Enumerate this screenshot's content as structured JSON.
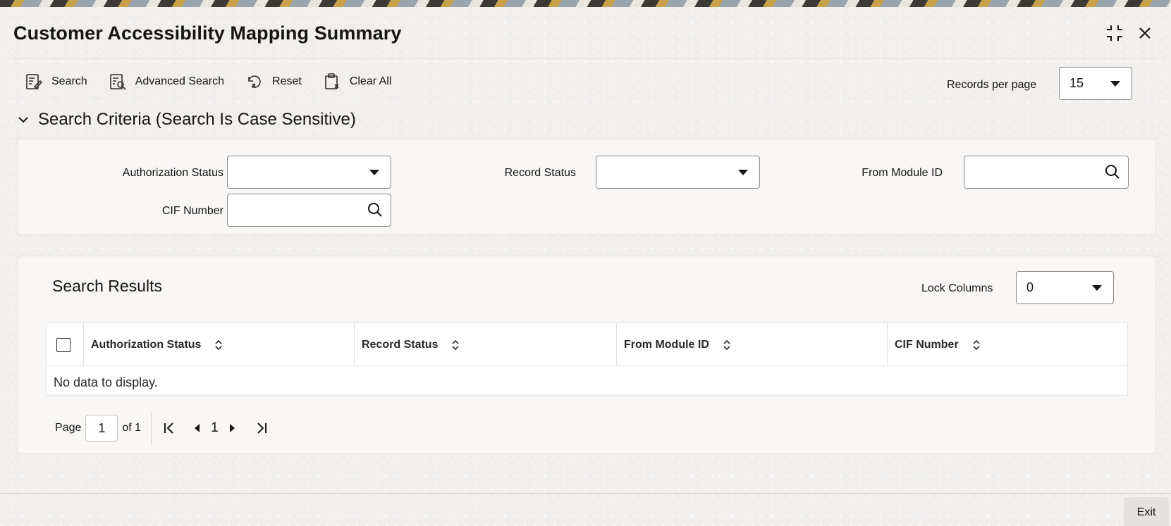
{
  "window": {
    "title": "Customer Accessibility Mapping Summary"
  },
  "toolbar": {
    "search_label": "Search",
    "advanced_search_label": "Advanced Search",
    "reset_label": "Reset",
    "clear_all_label": "Clear All"
  },
  "records_per_page": {
    "label": "Records per page",
    "value": "15"
  },
  "search_criteria": {
    "heading": "Search Criteria (Search Is Case Sensitive)",
    "authorization_status": {
      "label": "Authorization Status",
      "value": ""
    },
    "record_status": {
      "label": "Record Status",
      "value": ""
    },
    "from_module_id": {
      "label": "From Module ID",
      "value": ""
    },
    "cif_number": {
      "label": "CIF Number",
      "value": ""
    }
  },
  "results": {
    "title": "Search Results",
    "lock_columns": {
      "label": "Lock Columns",
      "value": "0"
    },
    "columns": [
      "Authorization Status",
      "Record Status",
      "From Module ID",
      "CIF Number"
    ],
    "empty_message": "No data to display."
  },
  "pagination": {
    "page_label": "Page",
    "current_page": "1",
    "of_label": "of 1",
    "page_number": "1"
  },
  "footer": {
    "exit_label": "Exit"
  },
  "icons": {
    "minimize": "minimize-icon",
    "close": "close-icon",
    "search": "search-icon",
    "advanced_search": "advanced-search-icon",
    "reset": "reset-icon",
    "clear_all": "clear-all-icon",
    "sort": "sort-icon",
    "lookup": "magnifier-icon"
  }
}
